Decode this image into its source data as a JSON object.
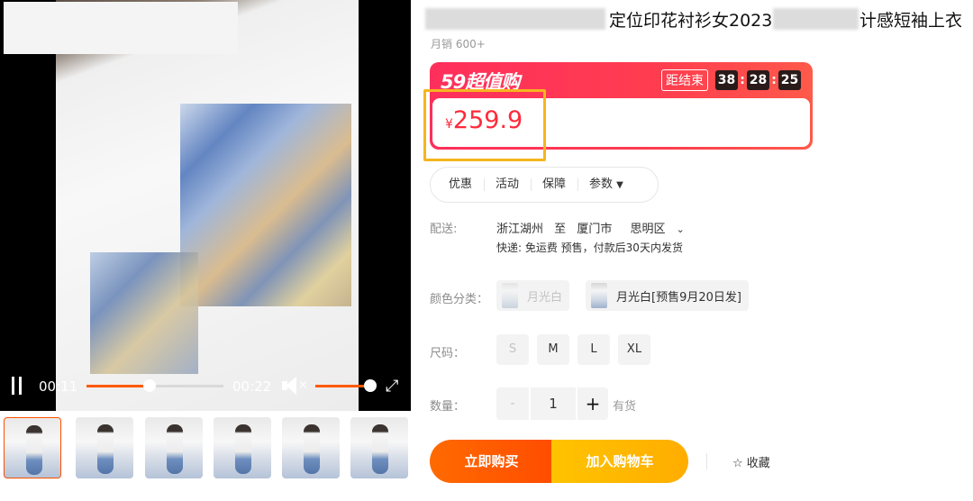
{
  "video": {
    "time_current": "00:11",
    "time_total": "00:22",
    "progress": 0.46,
    "volume": 1.0,
    "accent_color": "#ff5a00"
  },
  "title": {
    "part1": "定位印花衬衫女2023",
    "part2": "计感短袖上衣"
  },
  "sales": "月销 600+",
  "promo": {
    "logo": "59超值购",
    "countdown_label": "距结束",
    "hours": "38",
    "minutes": "28",
    "seconds": "25",
    "brand_color": "#ff2f5c"
  },
  "price": {
    "currency": "¥",
    "value": "259.9",
    "color": "#ff2a3a"
  },
  "tabs": [
    "优惠",
    "活动",
    "保障",
    "参数"
  ],
  "shipping": {
    "label": "配送:",
    "from": "浙江湖州",
    "to_word": "至",
    "city": "厦门市",
    "district": "思明区",
    "detail": "快递: 免运费  预售，付款后30天内发货"
  },
  "color": {
    "label": "颜色分类：",
    "options": [
      "月光白",
      "月光白[预售9月20日发]"
    ]
  },
  "size": {
    "label": "尺码：",
    "options": [
      "S",
      "M",
      "L",
      "XL"
    ]
  },
  "quantity": {
    "label": "数量：",
    "minus": "-",
    "value": "1",
    "plus": "+",
    "stock": "有货"
  },
  "actions": {
    "buy": "立即购买",
    "cart": "加入购物车",
    "favorite": "☆ 收藏",
    "buy_color": "#ff5000",
    "cart_color": "#ffb400"
  },
  "icons": {
    "pause": "pause-icon",
    "mute": "mute-icon",
    "fullscreen": "fullscreen-icon",
    "chevron": "chevron-down-icon",
    "star": "star-icon"
  }
}
